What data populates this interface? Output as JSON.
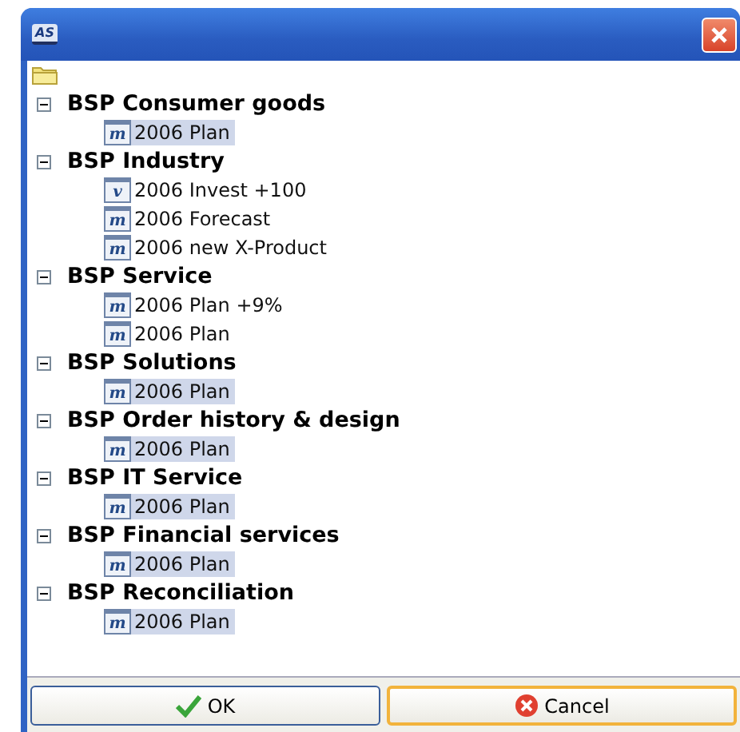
{
  "window": {
    "logo": "AS"
  },
  "tree": {
    "groups": [
      {
        "label": "BSP Consumer goods",
        "expanded": true,
        "children": [
          {
            "label": "2006 Plan",
            "icon_letter": "m",
            "selected": true
          }
        ]
      },
      {
        "label": "BSP Industry",
        "expanded": true,
        "children": [
          {
            "label": "2006 Invest +100",
            "icon_letter": "v",
            "selected": false
          },
          {
            "label": "2006 Forecast",
            "icon_letter": "m",
            "selected": false
          },
          {
            "label": "2006 new X-Product",
            "icon_letter": "m",
            "selected": false
          }
        ]
      },
      {
        "label": "BSP Service",
        "expanded": true,
        "children": [
          {
            "label": "2006 Plan +9%",
            "icon_letter": "m",
            "selected": false
          },
          {
            "label": "2006 Plan",
            "icon_letter": "m",
            "selected": false
          }
        ]
      },
      {
        "label": "BSP Solutions",
        "expanded": true,
        "children": [
          {
            "label": "2006 Plan",
            "icon_letter": "m",
            "selected": true
          }
        ]
      },
      {
        "label": "BSP Order history & design",
        "expanded": true,
        "children": [
          {
            "label": "2006 Plan",
            "icon_letter": "m",
            "selected": true
          }
        ]
      },
      {
        "label": "BSP IT Service",
        "expanded": true,
        "children": [
          {
            "label": "2006 Plan",
            "icon_letter": "m",
            "selected": true
          }
        ]
      },
      {
        "label": "BSP Financial services",
        "expanded": true,
        "children": [
          {
            "label": "2006 Plan",
            "icon_letter": "m",
            "selected": true
          }
        ]
      },
      {
        "label": "BSP Reconciliation",
        "expanded": true,
        "children": [
          {
            "label": "2006 Plan",
            "icon_letter": "m",
            "selected": true
          }
        ]
      }
    ]
  },
  "buttons": [
    {
      "label": "OK",
      "kind": "ok",
      "focused": false
    },
    {
      "label": "Cancel",
      "kind": "cancel",
      "focused": true
    }
  ]
}
